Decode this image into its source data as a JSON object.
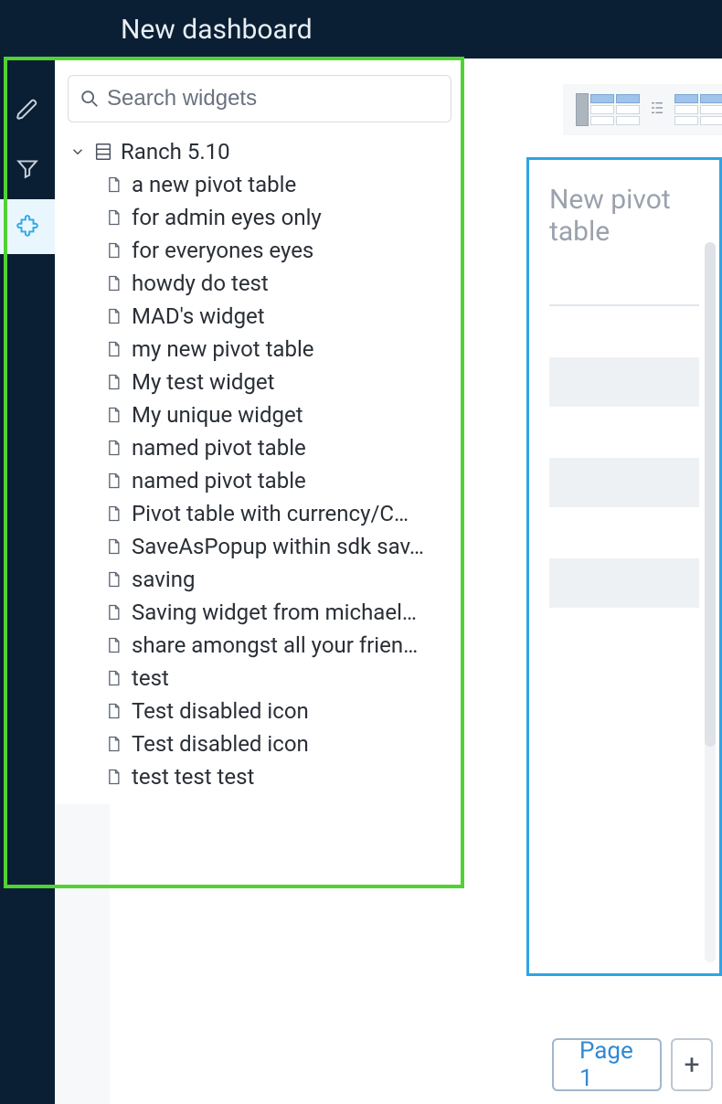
{
  "header": {
    "title": "New dashboard"
  },
  "rail": {
    "items": [
      {
        "name": "pencil-icon",
        "active": false
      },
      {
        "name": "filter-icon",
        "active": false
      },
      {
        "name": "puzzle-icon",
        "active": true
      }
    ]
  },
  "search": {
    "placeholder": "Search widgets"
  },
  "tree": {
    "parent_label": "Ranch 5.10",
    "items": [
      {
        "label": "a new pivot table"
      },
      {
        "label": "for admin eyes only"
      },
      {
        "label": "for everyones eyes"
      },
      {
        "label": "howdy do test"
      },
      {
        "label": "MAD's widget"
      },
      {
        "label": "my new pivot table"
      },
      {
        "label": "My test widget"
      },
      {
        "label": "My unique widget"
      },
      {
        "label": "named pivot table"
      },
      {
        "label": "named pivot table"
      },
      {
        "label": "Pivot table with currency/C…"
      },
      {
        "label": "SaveAsPopup within sdk sav…"
      },
      {
        "label": "saving"
      },
      {
        "label": "Saving widget from michael…"
      },
      {
        "label": "share amongst all your frien…"
      },
      {
        "label": "test"
      },
      {
        "label": "Test disabled icon"
      },
      {
        "label": "Test disabled icon"
      },
      {
        "label": "test test test"
      }
    ]
  },
  "pivot": {
    "title": "New pivot table"
  },
  "pages": {
    "current_label": "Page 1",
    "add_label": "+"
  }
}
